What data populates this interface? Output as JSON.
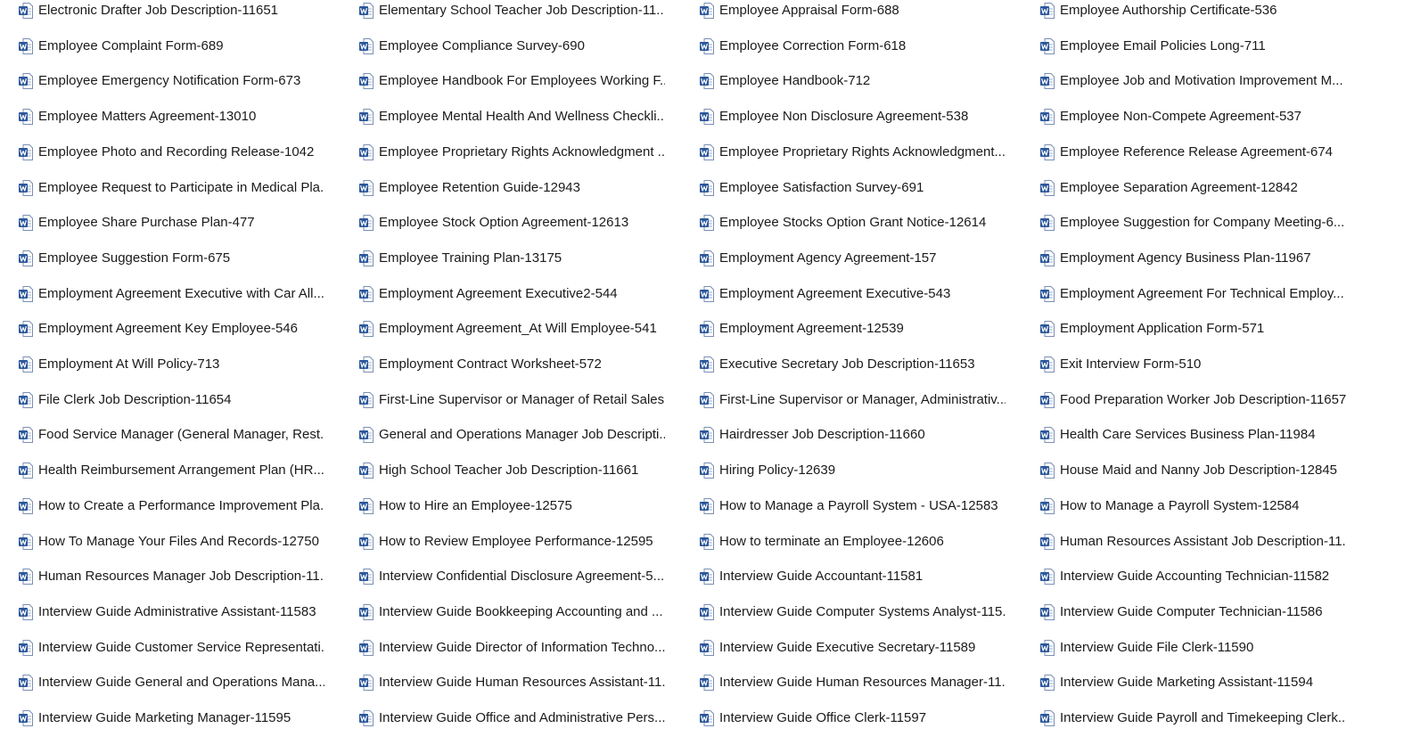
{
  "colors": {
    "background": "#ffffff",
    "text": "#1a1a1a",
    "word_icon_blue": "#2b579a"
  },
  "file_icon": "word-document-icon",
  "files": [
    "Electronic Drafter Job Description-11651",
    "Elementary School Teacher Job Description-11...",
    "Employee Appraisal Form-688",
    "Employee Authorship Certificate-536",
    "Employee Complaint Form-689",
    "Employee Compliance Survey-690",
    "Employee Correction Form-618",
    "Employee Email Policies Long-711",
    "Employee Emergency Notification Form-673",
    "Employee Handbook For Employees Working F...",
    "Employee Handbook-712",
    "Employee Job and Motivation Improvement M...",
    "Employee Matters Agreement-13010",
    "Employee Mental Health And Wellness Checkli...",
    "Employee Non Disclosure Agreement-538",
    "Employee Non-Compete Agreement-537",
    "Employee Photo and Recording Release-1042",
    "Employee Proprietary Rights Acknowledgment ...",
    "Employee Proprietary Rights Acknowledgment...",
    "Employee Reference Release Agreement-674",
    "Employee Request to Participate in Medical Pla...",
    "Employee Retention Guide-12943",
    "Employee Satisfaction Survey-691",
    "Employee Separation Agreement-12842",
    "Employee Share Purchase Plan-477",
    "Employee Stock Option Agreement-12613",
    "Employee Stocks Option Grant Notice-12614",
    "Employee Suggestion for Company Meeting-6...",
    "Employee Suggestion Form-675",
    "Employee Training Plan-13175",
    "Employment Agency Agreement-157",
    "Employment Agency Business Plan-11967",
    "Employment Agreement Executive with Car All...",
    "Employment Agreement Executive2-544",
    "Employment Agreement Executive-543",
    "Employment Agreement For Technical Employ...",
    "Employment Agreement Key Employee-546",
    "Employment Agreement_At Will Employee-541",
    "Employment Agreement-12539",
    "Employment Application Form-571",
    "Employment At Will Policy-713",
    "Employment Contract Worksheet-572",
    "Executive Secretary Job Description-11653",
    "Exit Interview Form-510",
    "File Clerk Job Description-11654",
    "First-Line Supervisor or Manager of Retail Sales...",
    "First-Line Supervisor or Manager, Administrativ...",
    "Food Preparation Worker Job Description-11657",
    "Food Service Manager (General Manager, Rest...",
    "General and Operations Manager Job Descripti...",
    "Hairdresser Job Description-11660",
    "Health Care Services Business Plan-11984",
    "Health Reimbursement Arrangement Plan (HR...",
    "High School Teacher Job Description-11661",
    "Hiring Policy-12639",
    "House Maid and Nanny Job Description-12845",
    "How to Create a Performance Improvement Pla...",
    "How to Hire an Employee-12575",
    "How to Manage a Payroll System - USA-12583",
    "How to Manage a Payroll System-12584",
    "How To Manage Your Files And Records-12750",
    "How to Review Employee Performance-12595",
    "How to terminate an Employee-12606",
    "Human Resources Assistant Job Description-11...",
    "Human Resources Manager Job Description-11...",
    "Interview Confidential Disclosure Agreement-5...",
    "Interview Guide Accountant-11581",
    "Interview Guide Accounting Technician-11582",
    "Interview Guide Administrative Assistant-11583",
    "Interview Guide Bookkeeping Accounting and ...",
    "Interview Guide Computer Systems Analyst-115...",
    "Interview Guide Computer Technician-11586",
    "Interview Guide Customer Service Representati...",
    "Interview Guide Director of Information Techno...",
    "Interview Guide Executive Secretary-11589",
    "Interview Guide File Clerk-11590",
    "Interview Guide General and Operations Mana...",
    "Interview Guide Human Resources Assistant-11...",
    "Interview Guide Human Resources Manager-11...",
    "Interview Guide Marketing Assistant-11594",
    "Interview Guide Marketing Manager-11595",
    "Interview Guide Office and Administrative Pers...",
    "Interview Guide Office Clerk-11597",
    "Interview Guide Payroll and Timekeeping Clerk..."
  ]
}
